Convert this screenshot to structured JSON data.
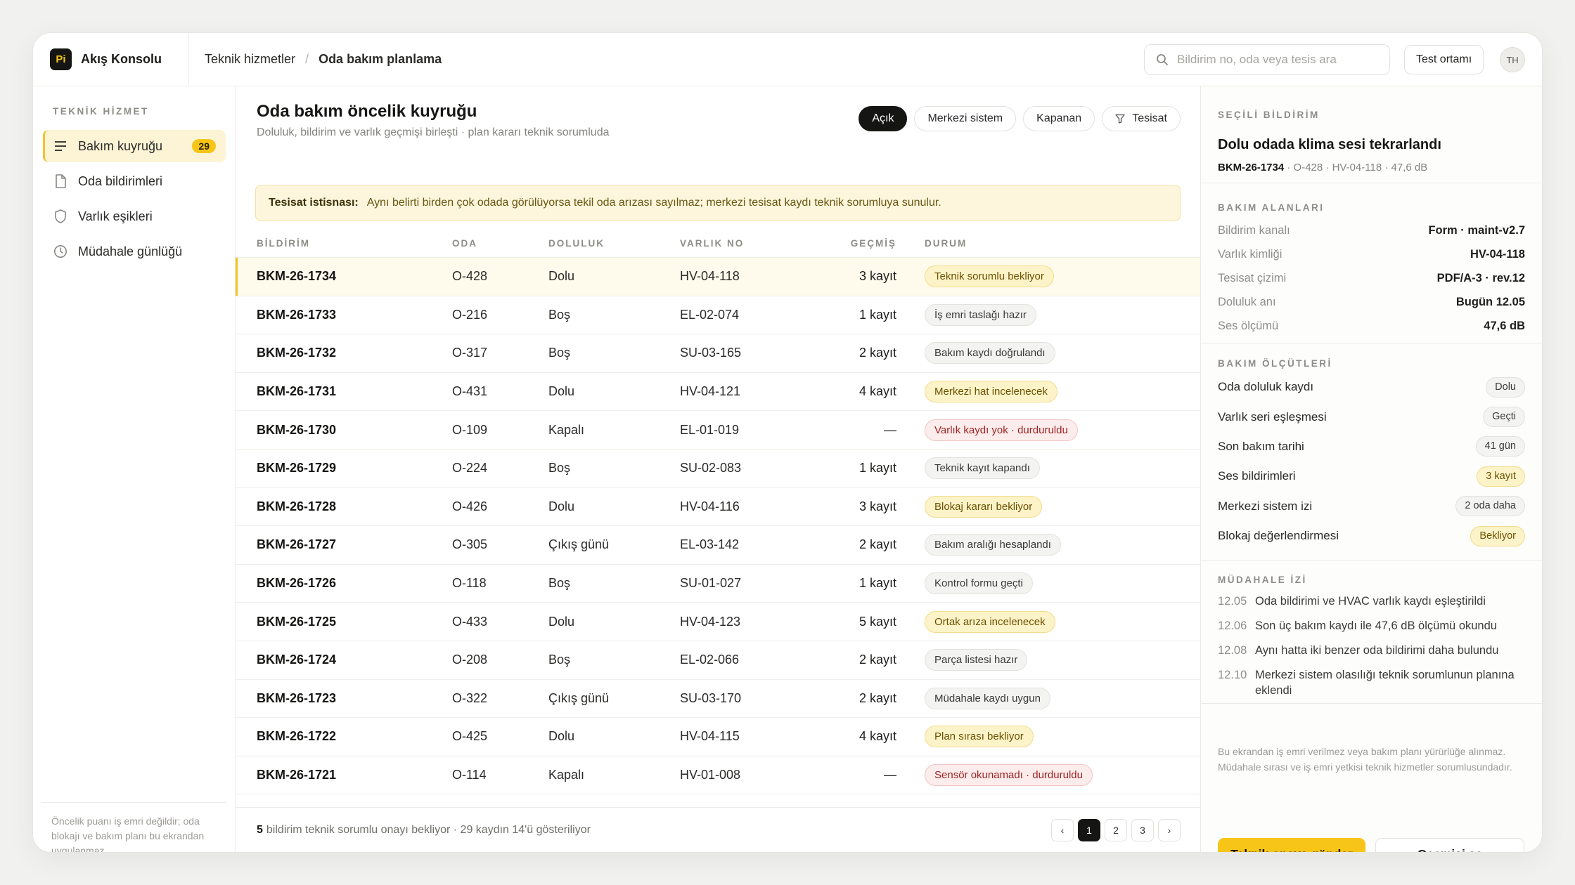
{
  "app": {
    "logo": "Pi",
    "name": "Akış Konsolu"
  },
  "breadcrumb": {
    "parent": "Teknik hizmetler",
    "separator": "/",
    "current": "Oda bakım planlama"
  },
  "search": {
    "placeholder": "Bildirim no, oda veya tesis ara"
  },
  "env_label": "Test ortamı",
  "avatar": "TH",
  "sidebar": {
    "heading": "TEKNİK HİZMET",
    "items": [
      {
        "label": "Bakım kuyruğu",
        "badge": "29",
        "icon": "list-icon"
      },
      {
        "label": "Oda bildirimleri",
        "icon": "file-icon"
      },
      {
        "label": "Varlık eşikleri",
        "icon": "shield-icon"
      },
      {
        "label": "Müdahale günlüğü",
        "icon": "clock-icon"
      }
    ],
    "footer": "Öncelik puanı iş emri değildir; oda blokajı ve bakım planı bu ekrandan uygulanmaz."
  },
  "main": {
    "title": "Oda bakım öncelik kuyruğu",
    "subtitle": "Doluluk, bildirim ve varlık geçmişi birleşti · plan kararı teknik sorumluda",
    "filters": [
      "Açık",
      "Merkezi sistem",
      "Kapanan",
      "Tesisat"
    ],
    "alert": {
      "label": "Tesisat istisnası:",
      "text": "Aynı belirti birden çok odada görülüyorsa tekil oda arızası sayılmaz; merkezi tesisat kaydı teknik sorumluya sunulur."
    },
    "columns": [
      "BİLDİRİM",
      "ODA",
      "DOLULUK",
      "VARLIK NO",
      "GEÇMİŞ",
      "DURUM"
    ],
    "rows": [
      {
        "id": "BKM-26-1734",
        "room": "O-428",
        "occ": "Dolu",
        "asset": "HV-04-118",
        "hist": "3 kayıt",
        "status": "Teknik sorumlu bekliyor",
        "tone": "warn"
      },
      {
        "id": "BKM-26-1733",
        "room": "O-216",
        "occ": "Boş",
        "asset": "EL-02-074",
        "hist": "1 kayıt",
        "status": "İş emri taslağı hazır",
        "tone": "neutral"
      },
      {
        "id": "BKM-26-1732",
        "room": "O-317",
        "occ": "Boş",
        "asset": "SU-03-165",
        "hist": "2 kayıt",
        "status": "Bakım kaydı doğrulandı",
        "tone": "neutral"
      },
      {
        "id": "BKM-26-1731",
        "room": "O-431",
        "occ": "Dolu",
        "asset": "HV-04-121",
        "hist": "4 kayıt",
        "status": "Merkezi hat incelenecek",
        "tone": "warn"
      },
      {
        "id": "BKM-26-1730",
        "room": "O-109",
        "occ": "Kapalı",
        "asset": "EL-01-019",
        "hist": "—",
        "status": "Varlık kaydı yok · durduruldu",
        "tone": "danger"
      },
      {
        "id": "BKM-26-1729",
        "room": "O-224",
        "occ": "Boş",
        "asset": "SU-02-083",
        "hist": "1 kayıt",
        "status": "Teknik kayıt kapandı",
        "tone": "neutral"
      },
      {
        "id": "BKM-26-1728",
        "room": "O-426",
        "occ": "Dolu",
        "asset": "HV-04-116",
        "hist": "3 kayıt",
        "status": "Blokaj kararı bekliyor",
        "tone": "warn"
      },
      {
        "id": "BKM-26-1727",
        "room": "O-305",
        "occ": "Çıkış günü",
        "asset": "EL-03-142",
        "hist": "2 kayıt",
        "status": "Bakım aralığı hesaplandı",
        "tone": "neutral"
      },
      {
        "id": "BKM-26-1726",
        "room": "O-118",
        "occ": "Boş",
        "asset": "SU-01-027",
        "hist": "1 kayıt",
        "status": "Kontrol formu geçti",
        "tone": "neutral"
      },
      {
        "id": "BKM-26-1725",
        "room": "O-433",
        "occ": "Dolu",
        "asset": "HV-04-123",
        "hist": "5 kayıt",
        "status": "Ortak arıza incelenecek",
        "tone": "warn"
      },
      {
        "id": "BKM-26-1724",
        "room": "O-208",
        "occ": "Boş",
        "asset": "EL-02-066",
        "hist": "2 kayıt",
        "status": "Parça listesi hazır",
        "tone": "neutral"
      },
      {
        "id": "BKM-26-1723",
        "room": "O-322",
        "occ": "Çıkış günü",
        "asset": "SU-03-170",
        "hist": "2 kayıt",
        "status": "Müdahale kaydı uygun",
        "tone": "neutral"
      },
      {
        "id": "BKM-26-1722",
        "room": "O-425",
        "occ": "Dolu",
        "asset": "HV-04-115",
        "hist": "4 kayıt",
        "status": "Plan sırası bekliyor",
        "tone": "warn"
      },
      {
        "id": "BKM-26-1721",
        "room": "O-114",
        "occ": "Kapalı",
        "asset": "HV-01-008",
        "hist": "—",
        "status": "Sensör okunamadı · durduruldu",
        "tone": "danger"
      }
    ],
    "footer": {
      "count": "5",
      "text": "bildirim teknik sorumlu onayı bekliyor · 29 kaydın 14'ü gösteriliyor"
    },
    "pager": {
      "prev": "‹",
      "pages": [
        "1",
        "2",
        "3"
      ],
      "next": "›"
    }
  },
  "panel": {
    "heading": "SEÇİLİ BİLDİRİM",
    "title": "Dolu odada klima sesi tekrarlandı",
    "meta_id": "BKM-26-1734",
    "meta_rest": " · O-428 · HV-04-118 · 47,6 dB",
    "fields_heading": "BAKIM ALANLARI",
    "fields": [
      {
        "k": "Bildirim kanalı",
        "v": "Form · maint-v2.7"
      },
      {
        "k": "Varlık kimliği",
        "v": "HV-04-118"
      },
      {
        "k": "Tesisat çizimi",
        "v": "PDF/A-3 · rev.12"
      },
      {
        "k": "Doluluk anı",
        "v": "Bugün 12.05"
      },
      {
        "k": "Ses ölçümü",
        "v": "47,6 dB"
      }
    ],
    "metrics_heading": "BAKIM ÖLÇÜTLERİ",
    "metrics": [
      {
        "k": "Oda doluluk kaydı",
        "v": "Dolu",
        "tone": "neutral"
      },
      {
        "k": "Varlık seri eşleşmesi",
        "v": "Geçti",
        "tone": "neutral"
      },
      {
        "k": "Son bakım tarihi",
        "v": "41 gün",
        "tone": "neutral"
      },
      {
        "k": "Ses bildirimleri",
        "v": "3 kayıt",
        "tone": "warn"
      },
      {
        "k": "Merkezi sistem izi",
        "v": "2 oda daha",
        "tone": "neutral"
      },
      {
        "k": "Blokaj değerlendirmesi",
        "v": "Bekliyor",
        "tone": "warn"
      }
    ],
    "log_heading": "MÜDAHALE İZİ",
    "log": [
      {
        "t": "12.05",
        "text": "Oda bildirimi ve HVAC varlık kaydı eşleştirildi"
      },
      {
        "t": "12.06",
        "text": "Son üç bakım kaydı ile 47,6 dB ölçümü okundu"
      },
      {
        "t": "12.08",
        "text": "Aynı hatta iki benzer oda bildirimi daha bulundu"
      },
      {
        "t": "12.10",
        "text": "Merkezi sistem olasılığı teknik sorumlunun planına eklendi"
      }
    ],
    "note": "Bu ekrandan iş emri verilmez veya bakım planı yürürlüğe alınmaz. Müdahale sırası ve iş emri yetkisi teknik hizmetler sorumlusundadır.",
    "primary_button": "Teknik onaya gönder",
    "secondary_button": "Geçmişi aç"
  },
  "colors": {
    "accent": "#f6c518",
    "dark": "#151513",
    "warn_bg": "#fdf3c9",
    "danger_text": "#9d2222"
  }
}
